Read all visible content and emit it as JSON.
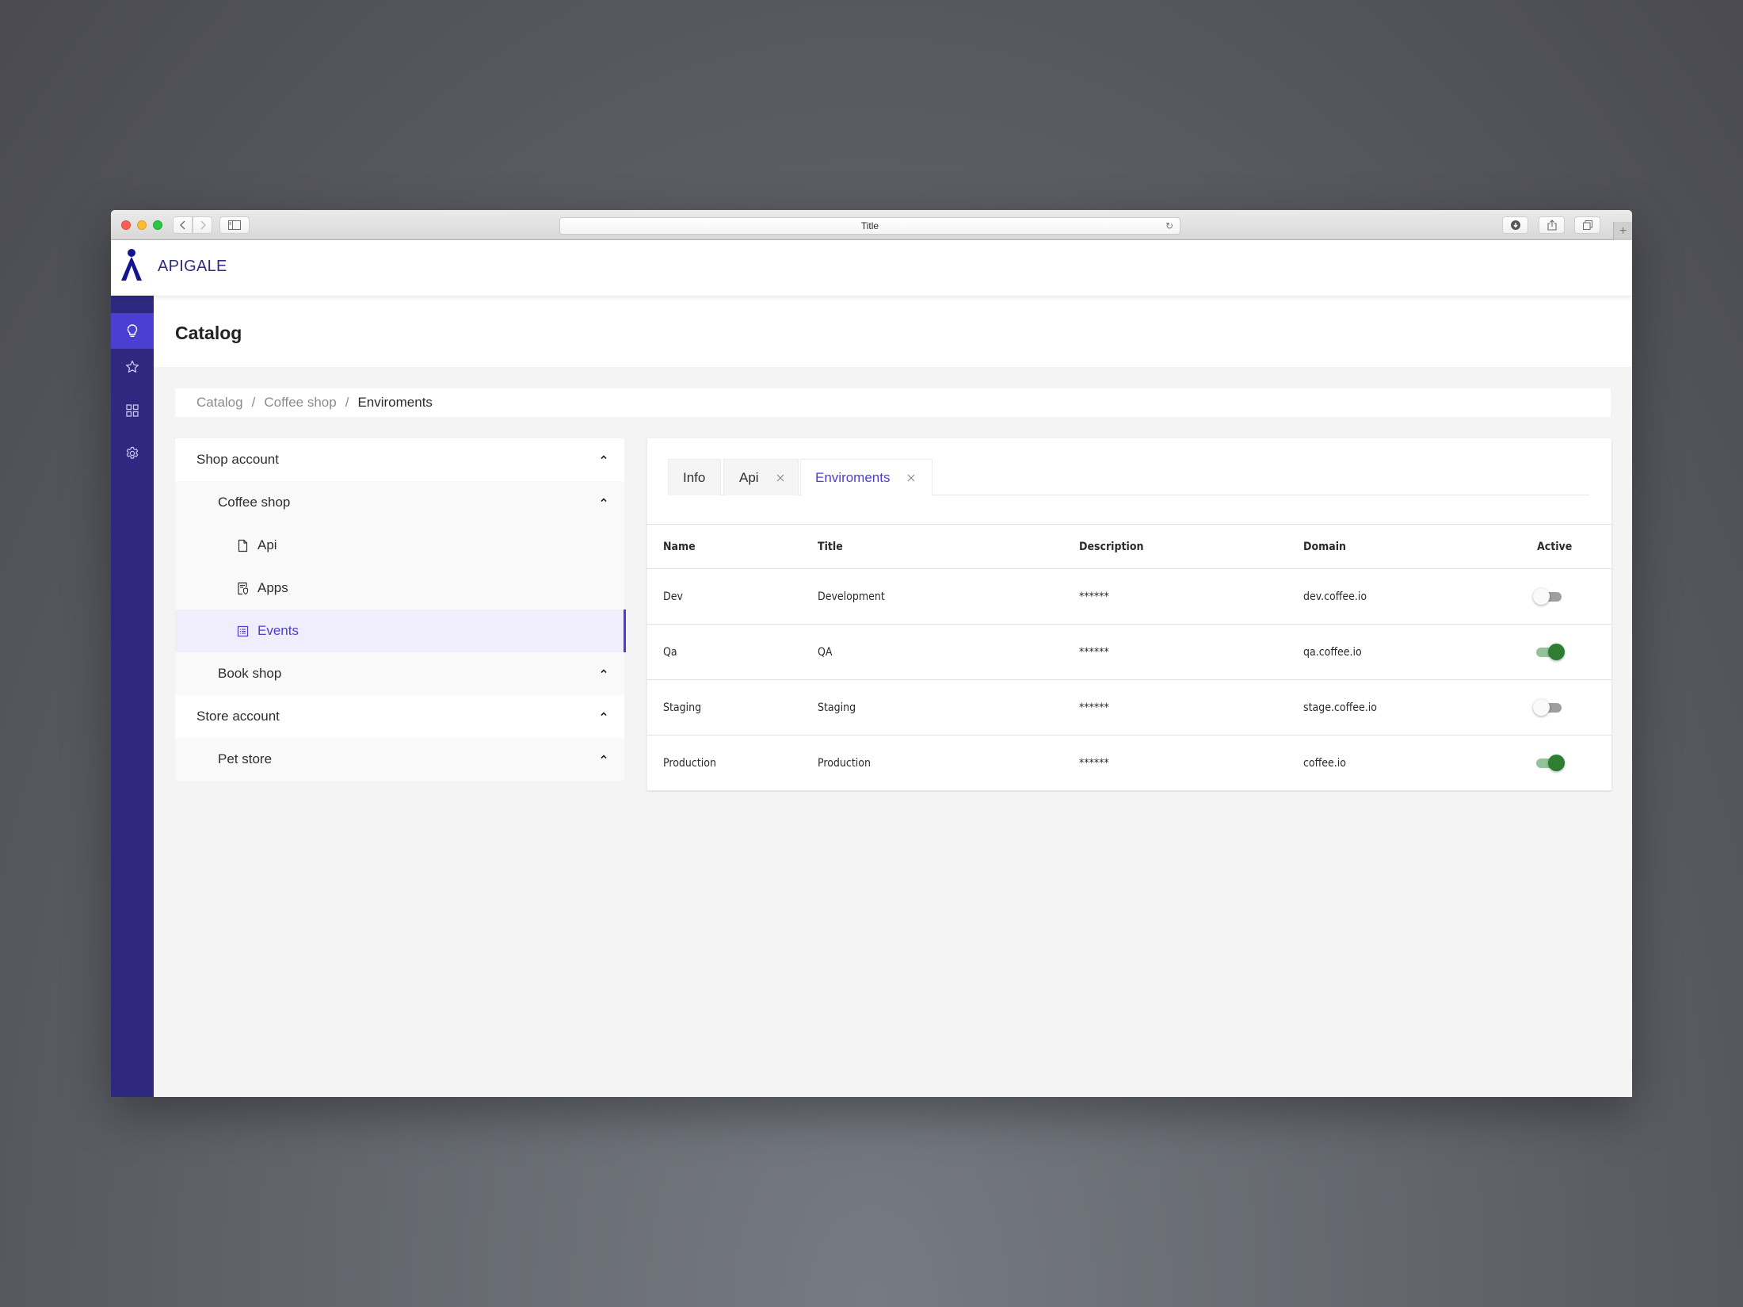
{
  "browser": {
    "address_title": "Title"
  },
  "app": {
    "brand": "APIGALE",
    "accent_color": "#4a3fd1",
    "rail_color": "#2e2880"
  },
  "rail": {
    "items": [
      {
        "icon": "lightbulb-icon",
        "active": true
      },
      {
        "icon": "star-icon",
        "active": false
      },
      {
        "icon": "grid-icon",
        "active": false
      },
      {
        "icon": "gear-icon",
        "active": false
      }
    ]
  },
  "page": {
    "title": "Catalog"
  },
  "breadcrumb": {
    "items": [
      "Catalog",
      "Coffee shop",
      "Enviroments"
    ],
    "separator": "/"
  },
  "tree": {
    "items": [
      {
        "label": "Shop account",
        "level": 1,
        "expanded": true
      },
      {
        "label": "Coffee shop",
        "level": 2,
        "expanded": true
      },
      {
        "label": "Api",
        "level": 3,
        "icon": "document-icon"
      },
      {
        "label": "Apps",
        "level": 3,
        "icon": "app-certificate-icon"
      },
      {
        "label": "Events",
        "level": 3,
        "icon": "list-icon",
        "selected": true
      },
      {
        "label": "Book shop",
        "level": 2,
        "expanded": true
      },
      {
        "label": "Store account",
        "level": 1,
        "expanded": true
      },
      {
        "label": "Pet store",
        "level": 2,
        "expanded": true
      }
    ]
  },
  "tabs": [
    {
      "label": "Info",
      "closable": false,
      "active": false
    },
    {
      "label": "Api",
      "closable": true,
      "active": false
    },
    {
      "label": "Enviroments",
      "closable": true,
      "active": true
    }
  ],
  "table": {
    "headers": [
      "Name",
      "Title",
      "Description",
      "Domain",
      "Active"
    ],
    "rows": [
      {
        "name": "Dev",
        "title": "Development",
        "description": "******",
        "domain": "dev.coffee.io",
        "active": false
      },
      {
        "name": "Qa",
        "title": "QA",
        "description": "******",
        "domain": "qa.coffee.io",
        "active": true
      },
      {
        "name": "Staging",
        "title": "Staging",
        "description": "******",
        "domain": "stage.coffee.io",
        "active": false
      },
      {
        "name": "Production",
        "title": "Production",
        "description": "******",
        "domain": "coffee.io",
        "active": true
      }
    ]
  }
}
